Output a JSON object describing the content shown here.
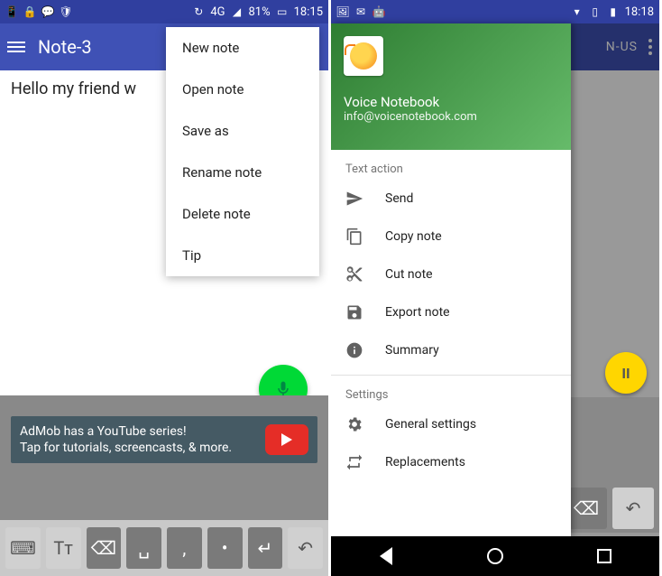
{
  "phone1": {
    "status": {
      "left_icons": [
        "📱",
        "🔒",
        "💬",
        "🛡"
      ],
      "signal_text": "4G",
      "battery_text": "81%",
      "time": "18:15"
    },
    "appbar": {
      "title": "Note-3"
    },
    "body_text": "Hello my friend w",
    "menu": [
      {
        "label": "New note"
      },
      {
        "label": "Open note"
      },
      {
        "label": "Save as"
      },
      {
        "label": "Rename note"
      },
      {
        "label": "Delete note"
      },
      {
        "label": "Tip"
      }
    ],
    "ad": {
      "line1": "AdMob has a YouTube series!",
      "line2": "Tap for tutorials, screencasts, & more."
    },
    "kb_keys": [
      {
        "icon": "keyboard",
        "glyph": "⌨"
      },
      {
        "icon": "textsize",
        "glyph": "Tт"
      },
      {
        "icon": "backspace",
        "glyph": "⌫"
      },
      {
        "icon": "space",
        "glyph": "␣"
      },
      {
        "icon": "comma",
        "glyph": ","
      },
      {
        "icon": "period",
        "glyph": "•"
      },
      {
        "icon": "enter",
        "glyph": "↵"
      },
      {
        "icon": "undo",
        "glyph": "↶"
      }
    ]
  },
  "phone2": {
    "status": {
      "left_icons": [
        "🖼",
        "✉",
        "🤖"
      ],
      "time": "18:18"
    },
    "appbar": {
      "lang": "N-US"
    },
    "drawer": {
      "title": "Voice Notebook",
      "subtitle": "info@voicenotebook.com",
      "sections": [
        {
          "header": "Text action",
          "items": [
            {
              "icon": "send",
              "label": "Send"
            },
            {
              "icon": "copy",
              "label": "Copy note"
            },
            {
              "icon": "cut",
              "label": "Cut note"
            },
            {
              "icon": "save",
              "label": "Export note"
            },
            {
              "icon": "info",
              "label": "Summary"
            }
          ]
        },
        {
          "header": "Settings",
          "items": [
            {
              "icon": "gear",
              "label": "General settings"
            },
            {
              "icon": "swap",
              "label": "Replacements"
            }
          ]
        }
      ]
    },
    "pause_label": "II"
  }
}
